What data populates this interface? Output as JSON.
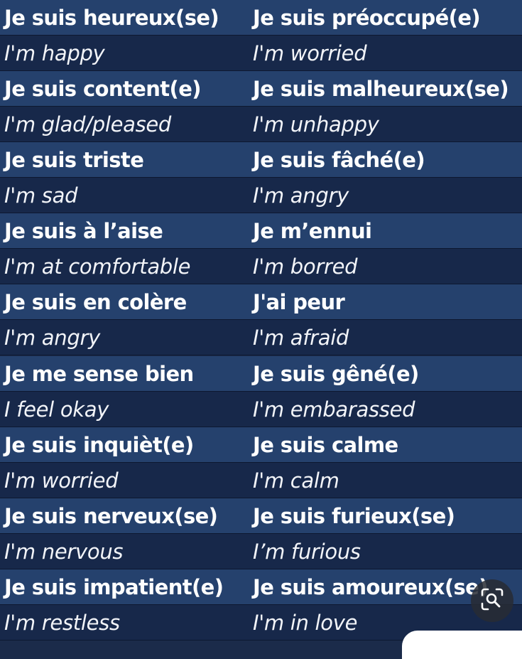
{
  "rows": [
    {
      "type": "french",
      "left": "Je suis heureux(se)",
      "right": "Je suis préoccupé(e)"
    },
    {
      "type": "english",
      "left": "I'm happy",
      "right": "I'm worried"
    },
    {
      "type": "french",
      "left": "Je suis content(e)",
      "right": "Je suis malheureux(se)"
    },
    {
      "type": "english",
      "left": "I'm glad/pleased",
      "right": "I'm unhappy"
    },
    {
      "type": "french",
      "left": "Je suis triste",
      "right": "Je suis fâché(e)"
    },
    {
      "type": "english",
      "left": "I'm sad",
      "right": "I'm angry"
    },
    {
      "type": "french",
      "left": "Je suis à l’aise",
      "right": "Je m’ennui"
    },
    {
      "type": "english",
      "left": "I'm at comfortable",
      "right": "I'm borred"
    },
    {
      "type": "french",
      "left": "Je suis en colère",
      "right": "J'ai peur"
    },
    {
      "type": "english",
      "left": "I'm angry",
      "right": "I'm afraid"
    },
    {
      "type": "french",
      "left": "Je me sense bien",
      "right": "Je suis gêné(e)"
    },
    {
      "type": "english",
      "left": "I feel okay",
      "right": "I'm embarassed"
    },
    {
      "type": "french",
      "left": "Je suis inquièt(e)",
      "right": "Je suis calme"
    },
    {
      "type": "english",
      "left": "I'm worried",
      "right": "I'm calm"
    },
    {
      "type": "french",
      "left": "Je suis nerveux(se)",
      "right": "Je suis furieux(se)"
    },
    {
      "type": "english",
      "left": "I'm nervous",
      "right": "I’m furious"
    },
    {
      "type": "french",
      "left": "Je suis impatient(e)",
      "right": "Je suis amoureux(se)"
    },
    {
      "type": "english",
      "left": "I'm restless",
      "right": "I'm in love"
    }
  ],
  "colors": {
    "french_row": "#25416d",
    "english_row": "#17284a",
    "text": "#ffffff"
  },
  "lens": {
    "icon": "visual-search-icon"
  }
}
